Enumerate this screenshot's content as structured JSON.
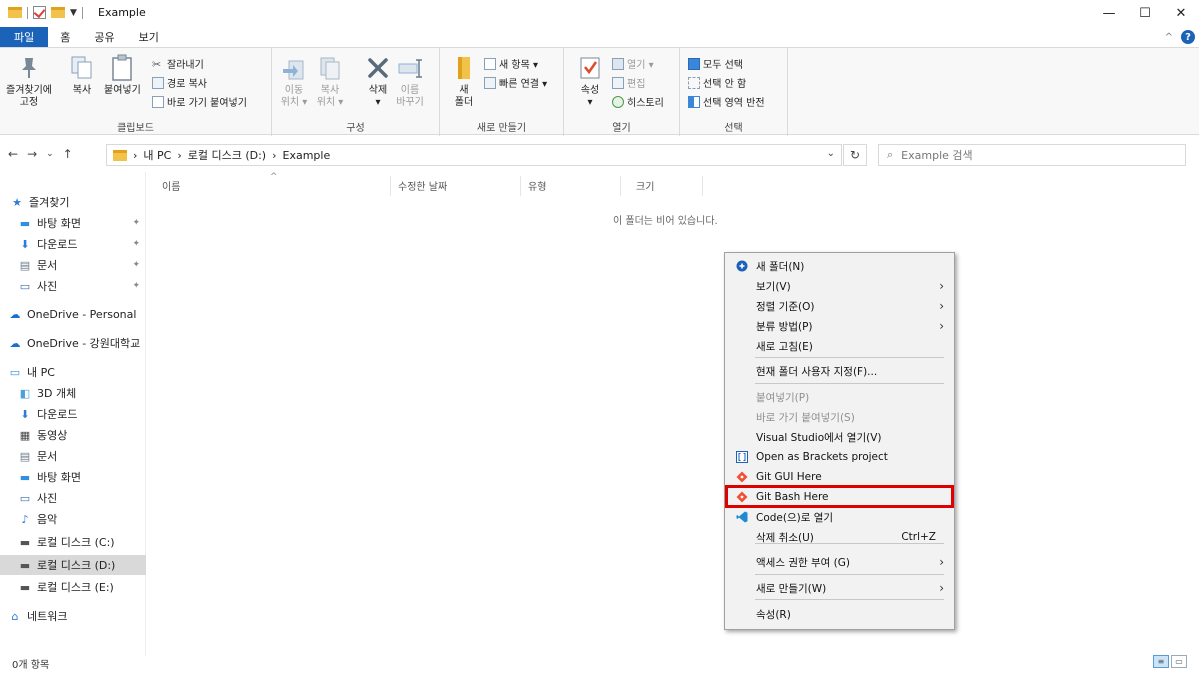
{
  "window": {
    "title": "Example",
    "minimize": "—",
    "maximize": "☐",
    "close": "✕"
  },
  "ribbon_tabs": [
    "파일",
    "홈",
    "공유",
    "보기"
  ],
  "ribbon": {
    "clipboard": {
      "label": "클립보드",
      "pin_line1": "즐겨찾기에",
      "pin_line2": "고정",
      "copy": "복사",
      "paste": "붙여넣기",
      "cut": "잘라내기",
      "copy_path": "경로 복사",
      "paste_shortcut": "바로 가기 붙여넣기"
    },
    "organize": {
      "label": "구성",
      "move_line1": "이동",
      "move_line2": "위치 ▾",
      "copyto_line1": "복사",
      "copyto_line2": "위치 ▾",
      "delete": "삭제",
      "delete_arrow": "▾",
      "rename_line1": "이름",
      "rename_line2": "바꾸기"
    },
    "new": {
      "label": "새로 만들기",
      "new_folder_line1": "새",
      "new_folder_line2": "폴더",
      "new_item": "새 항목 ▾",
      "easy_access": "빠른 연결 ▾"
    },
    "open": {
      "label": "열기",
      "properties": "속성",
      "properties_arrow": "▾",
      "open": "열기 ▾",
      "edit": "편집",
      "history": "히스토리"
    },
    "select": {
      "label": "선택",
      "select_all": "모두 선택",
      "select_none": "선택 안 함",
      "invert": "선택 영역 반전"
    }
  },
  "address": {
    "back": "←",
    "forward": "→",
    "recent": "⌄",
    "up": "↑",
    "crumbs": [
      "›",
      "내 PC",
      "›",
      "로컬 디스크 (D:)",
      "›",
      "Example"
    ],
    "dropdown": "⌄",
    "refresh": "↻",
    "search_placeholder": "Example 검색"
  },
  "sidebar": {
    "items": [
      {
        "label": "즐겨찾기",
        "icon": "star-icon"
      },
      {
        "label": "바탕 화면",
        "icon": "desktop-icon",
        "pinned": true
      },
      {
        "label": "다운로드",
        "icon": "download-icon",
        "pinned": true
      },
      {
        "label": "문서",
        "icon": "document-icon",
        "pinned": true
      },
      {
        "label": "사진",
        "icon": "picture-icon",
        "pinned": true
      },
      {
        "label": "OneDrive - Personal",
        "icon": "cloud-icon"
      },
      {
        "label": "OneDrive - 강원대학교",
        "icon": "cloud-icon"
      },
      {
        "label": "내 PC",
        "icon": "pc-icon"
      },
      {
        "label": "3D 개체",
        "icon": "cube-icon"
      },
      {
        "label": "다운로드",
        "icon": "download-icon"
      },
      {
        "label": "동영상",
        "icon": "video-icon"
      },
      {
        "label": "문서",
        "icon": "document-icon"
      },
      {
        "label": "바탕 화면",
        "icon": "desktop-icon"
      },
      {
        "label": "사진",
        "icon": "picture-icon"
      },
      {
        "label": "음악",
        "icon": "music-icon"
      },
      {
        "label": "로컬 디스크 (C:)",
        "icon": "drive-icon"
      },
      {
        "label": "로컬 디스크 (D:)",
        "icon": "drive-icon",
        "selected": true
      },
      {
        "label": "로컬 디스크 (E:)",
        "icon": "drive-icon"
      },
      {
        "label": "네트워크",
        "icon": "network-icon"
      }
    ]
  },
  "columns": {
    "name": "이름",
    "date": "수정한 날짜",
    "type": "유형",
    "size": "크기"
  },
  "empty_message": "이 폴더는 비어 있습니다.",
  "status": {
    "count": "0개 항목"
  },
  "context_menu": {
    "items": [
      {
        "label": "새 폴더(N)",
        "icon": "new-folder-icon"
      },
      {
        "label": "보기(V)",
        "submenu": true
      },
      {
        "label": "정렬 기준(O)",
        "submenu": true
      },
      {
        "label": "분류 방법(P)",
        "submenu": true
      },
      {
        "label": "새로 고침(E)"
      },
      {
        "label": "현재 폴더 사용자 지정(F)..."
      },
      {
        "label": "붙여넣기(P)",
        "disabled": true
      },
      {
        "label": "바로 가기 붙여넣기(S)",
        "disabled": true
      },
      {
        "label": "Visual Studio에서 열기(V)"
      },
      {
        "label": "Open as Brackets project",
        "icon": "brackets-icon"
      },
      {
        "label": "Git GUI Here",
        "icon": "git-icon"
      },
      {
        "label": "Git Bash Here",
        "icon": "git-icon",
        "highlighted": true
      },
      {
        "label": "Code(으)로 열기",
        "icon": "vscode-icon"
      },
      {
        "label": "삭제 취소(U)",
        "shortcut": "Ctrl+Z"
      },
      {
        "label": "액세스 권한 부여 (G)",
        "submenu": true
      },
      {
        "label": "새로 만들기(W)",
        "submenu": true
      },
      {
        "label": "속성(R)"
      }
    ],
    "submenu_arrow": "›",
    "highlight_color": "#e00000"
  },
  "colors": {
    "accent": "#1a63b8",
    "folder": "#f2c24a",
    "selection": "#d9d9d9"
  }
}
